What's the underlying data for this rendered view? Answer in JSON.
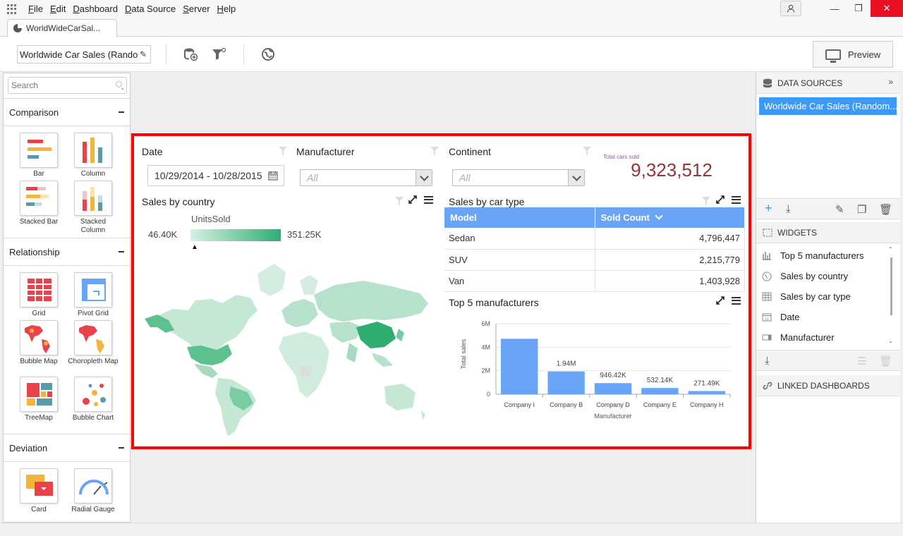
{
  "menu": [
    "File",
    "Edit",
    "Dashboard",
    "Data Source",
    "Server",
    "Help"
  ],
  "window_buttons": {
    "minimize": "—",
    "restore": "❐",
    "close": "✕"
  },
  "doc_tab": {
    "label": "WorldWideCarSal..."
  },
  "toolbar": {
    "dashboard_name": "Worldwide Car Sales (Rando",
    "preview_label": "Preview"
  },
  "palette": {
    "search_placeholder": "Search",
    "sections": {
      "comparison": "Comparison",
      "relationship": "Relationship",
      "deviation": "Deviation"
    },
    "items": {
      "bar": "Bar",
      "column": "Column",
      "stacked_bar": "Stacked Bar",
      "stacked_column": "Stacked Column",
      "grid": "Grid",
      "pivot_grid": "Pivot Grid",
      "bubble_map": "Bubble Map",
      "choropleth_map": "Choropleth Map",
      "treemap": "TreeMap",
      "bubble_chart": "Bubble Chart",
      "card": "Card",
      "radial_gauge": "Radial Gauge"
    }
  },
  "filters": {
    "date": {
      "title": "Date",
      "value": "10/29/2014 - 10/28/2015"
    },
    "manufacturer": {
      "title": "Manufacturer",
      "value": "All"
    },
    "continent": {
      "title": "Continent",
      "value": "All"
    }
  },
  "kpi": {
    "label": "Total cars sold",
    "value": "9,323,512"
  },
  "map_widget": {
    "title": "Sales by country",
    "legend_title": "UnitsSold",
    "legend_min": "46.40K",
    "legend_max": "351.25K",
    "colors": {
      "low": "#d8f0e4",
      "high": "#2fae72"
    }
  },
  "grid_widget": {
    "title": "Sales by car type",
    "headers": [
      "Model",
      "Sold Count"
    ],
    "rows": [
      [
        "Sedan",
        "4,796,447"
      ],
      [
        "SUV",
        "2,215,779"
      ],
      [
        "Van",
        "1,403,928"
      ]
    ]
  },
  "chart_data": {
    "type": "bar",
    "title": "Top 5 manufacturers",
    "categories": [
      "Company I",
      "Company B",
      "Company D",
      "Company E",
      "Company H"
    ],
    "values": [
      4.72,
      1.94,
      0.94642,
      0.53214,
      0.27149
    ],
    "data_labels": [
      "",
      "1.94M",
      "946.42K",
      "532.14K",
      "271.49K"
    ],
    "xlabel": "Manufacturer",
    "ylabel": "Total sales",
    "ylim": [
      0,
      6
    ],
    "yticks": [
      "0",
      "2M",
      "4M",
      "6M"
    ],
    "grid": true,
    "color": "#6aa4f6"
  },
  "right_panel": {
    "data_sources_title": "DATA SOURCES",
    "data_source_item": "Worldwide Car Sales (Random...",
    "widgets_title": "WIDGETS",
    "widgets": [
      "Top 5 manufacturers",
      "Sales by country",
      "Sales by car type",
      "Date",
      "Manufacturer"
    ],
    "linked_title": "LINKED DASHBOARDS"
  }
}
